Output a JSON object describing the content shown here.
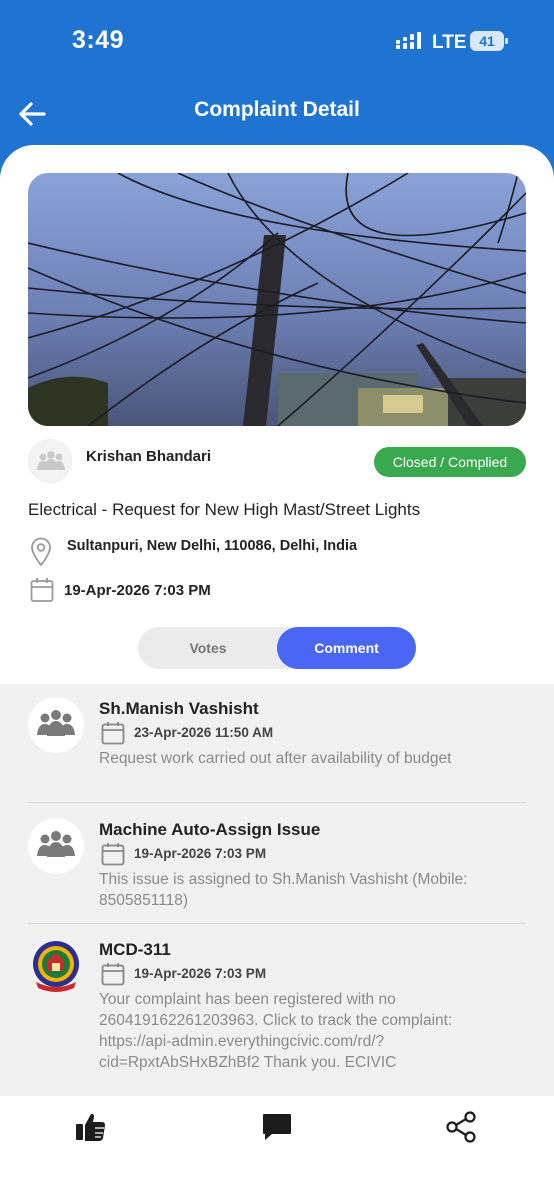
{
  "status_bar": {
    "time": "3:49",
    "network": "LTE",
    "battery": "41"
  },
  "header": {
    "title": "Complaint Detail",
    "back_icon": "arrow-left-icon"
  },
  "complaint": {
    "user_name": "Krishan Bhandari",
    "status": "Closed / Complied",
    "status_color": "#3aa84f",
    "category": "Electrical - Request for New High Mast/Street Lights",
    "location": "Sultanpuri, New Delhi, 110086, Delhi, India",
    "date": "19-Apr-2026 7:03 PM"
  },
  "tabs": [
    {
      "label": "Votes",
      "active": false
    },
    {
      "label": "Comment",
      "active": true
    }
  ],
  "accent_color": "#4a66f4",
  "comments": [
    {
      "author": "Sh.Manish Vashisht",
      "date": "23-Apr-2026 11:50 AM",
      "text": "Request work carried out after availability of budget",
      "avatar": "users-group-icon"
    },
    {
      "author": "Machine Auto-Assign Issue",
      "date": "19-Apr-2026 7:03 PM",
      "text": "This issue is assigned to Sh.Manish Vashisht (Mobile: 8505851118)",
      "avatar": "users-group-icon"
    },
    {
      "author": "MCD-311",
      "date": "19-Apr-2026 7:03 PM",
      "text": "Your complaint has been registered with no 260419162261203963. Click to track the complaint: https://api-admin.everythingcivic.com/rd/?cid=RpxtAbSHxBZhBf2 Thank you. ECIVIC",
      "avatar": "mcd-logo"
    }
  ],
  "bottom_bar": [
    "thumbs-up-icon",
    "comment-icon",
    "share-icon"
  ]
}
